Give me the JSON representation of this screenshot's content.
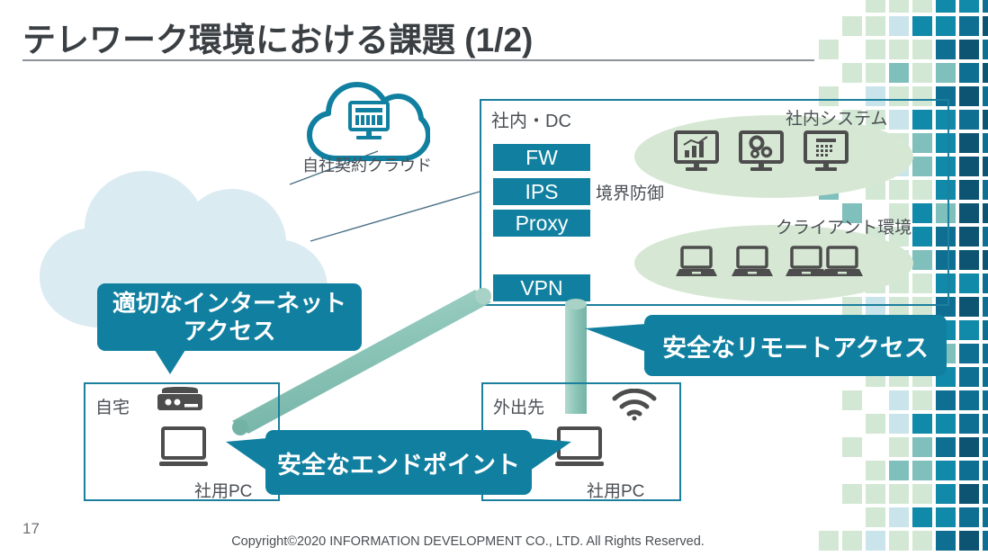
{
  "slide": {
    "title": "テレワーク環境における課題 (1/2)",
    "page_number": "17",
    "copyright": "Copyright©2020 INFORMATION DEVELOPMENT CO., LTD. All Rights Reserved."
  },
  "colors": {
    "teal": "#1180a0",
    "teal_border": "#1b7f9e",
    "dark_teal": "#0d5f7a",
    "title_text": "#3a3f43",
    "body_text": "#4a4f54",
    "cloud_fill": "#dbebf2",
    "green_ellipse": "#d6e8d4",
    "tunnel_green": "#8fc7ba",
    "icon_gray": "#4d4d4d",
    "rule_gray": "#8d9298"
  },
  "cloud": {
    "own_cloud_label": "自社契約クラウド",
    "own_cloud_icon": "cloud-with-monitor-icon",
    "internet_cloud_icon": "internet-cloud-shape"
  },
  "datacenter": {
    "label": "社内・DC",
    "boundary_label": "境界防御",
    "services": [
      {
        "label": "FW"
      },
      {
        "label": "IPS"
      },
      {
        "label": "Proxy"
      },
      {
        "label": "VPN"
      }
    ],
    "internal_systems": {
      "label": "社内システム",
      "icons": [
        "monitor-chart-icon",
        "monitor-gears-icon",
        "monitor-calendar-icon"
      ]
    },
    "client_environment": {
      "label": "クライアント環境",
      "icons": [
        "laptop-icon",
        "laptop-icon",
        "laptop-icon",
        "laptop-icon"
      ]
    }
  },
  "locations": [
    {
      "label": "自宅",
      "device_label": "社用PC",
      "icons": [
        "router-icon",
        "laptop-icon"
      ]
    },
    {
      "label": "外出先",
      "device_label": "社用PC",
      "icons": [
        "wifi-icon",
        "laptop-icon"
      ]
    }
  ],
  "callouts": [
    {
      "id": "internet",
      "line1": "適切なインターネット",
      "line2": "アクセス"
    },
    {
      "id": "remote",
      "line1": "安全なリモートアクセス",
      "line2": ""
    },
    {
      "id": "endpoint",
      "line1": "安全なエンドポイント",
      "line2": ""
    }
  ],
  "mosaic": {
    "palette": [
      "#d3e8d4",
      "#7fbfbc",
      "#1189a8",
      "#0f6f92",
      "#0d5472",
      "#c9e4ea",
      "#e3f0e5",
      "#a9d4d6"
    ],
    "cell": 22,
    "gap": 4
  }
}
